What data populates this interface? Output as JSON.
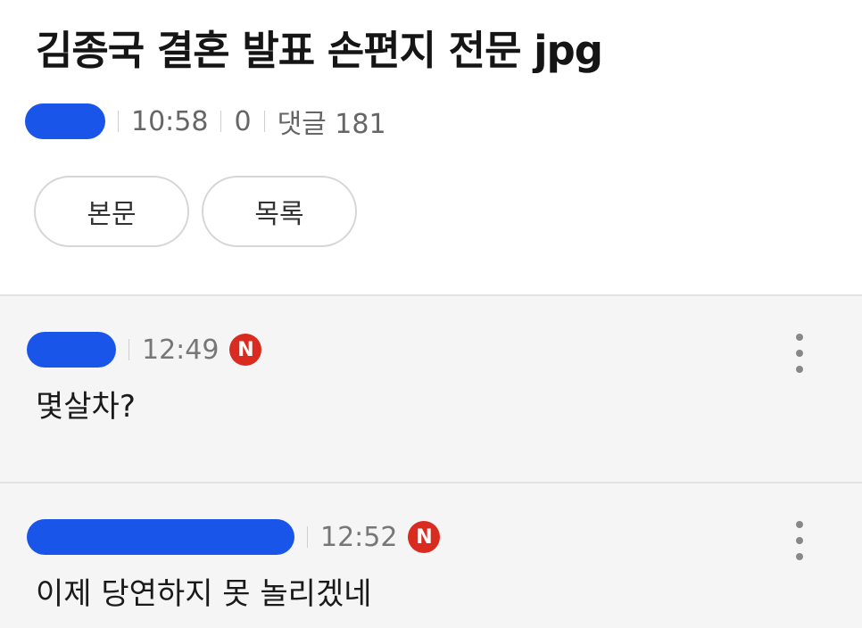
{
  "post": {
    "title": "김종국 결혼 발표 손편지 전문 jpg",
    "time": "10:58",
    "views": "0",
    "comments_label": "댓글 181"
  },
  "actions": {
    "body_label": "본문",
    "list_label": "목록"
  },
  "comments": [
    {
      "time": "12:49",
      "badge": "N",
      "text": "몇살차?"
    },
    {
      "time": "12:52",
      "badge": "N",
      "text": "이제 당연하지 못 놀리겠네"
    }
  ],
  "colors": {
    "redaction": "#1a55ea",
    "new_badge": "#d92b1f",
    "comment_bg": "#f5f5f5"
  },
  "icons": {
    "more": "more-vertical-icon",
    "new": "new-badge-icon"
  }
}
